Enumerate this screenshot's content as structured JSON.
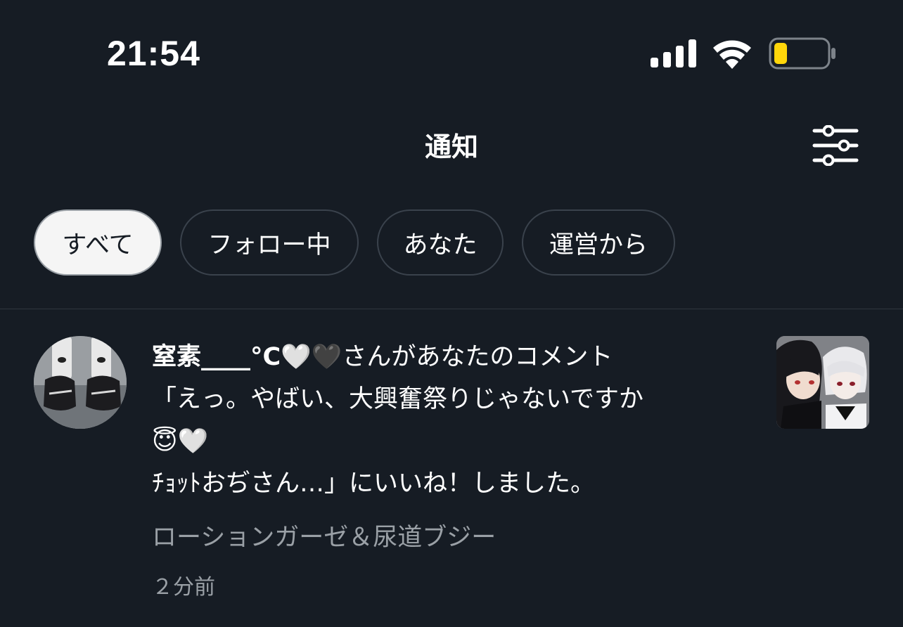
{
  "status_bar": {
    "time": "21:54",
    "battery_color": "#ffd60a"
  },
  "header": {
    "title": "通知",
    "settings_icon": "sliders-icon"
  },
  "tabs": [
    {
      "label": "すべて",
      "active": true
    },
    {
      "label": "フォロー中",
      "active": false
    },
    {
      "label": "あなた",
      "active": false
    },
    {
      "label": "運営から",
      "active": false
    }
  ],
  "notifications": [
    {
      "user_name": "窒素____°C🤍🖤",
      "line1_rest": "さんがあなたのコメント",
      "line2": "「えっ。やばい、大興奮祭りじゃないですか",
      "line3": "😇🤍",
      "line4": "ﾁｮｯﾄおぢさん…」にいいね！しました。",
      "post_title": "ローションガーゼ＆尿道ブジー",
      "time_ago": "２分前"
    }
  ],
  "colors": {
    "background": "#161c24",
    "tab_active_bg": "#f5f5f5",
    "secondary_text": "#9aa0a6"
  }
}
